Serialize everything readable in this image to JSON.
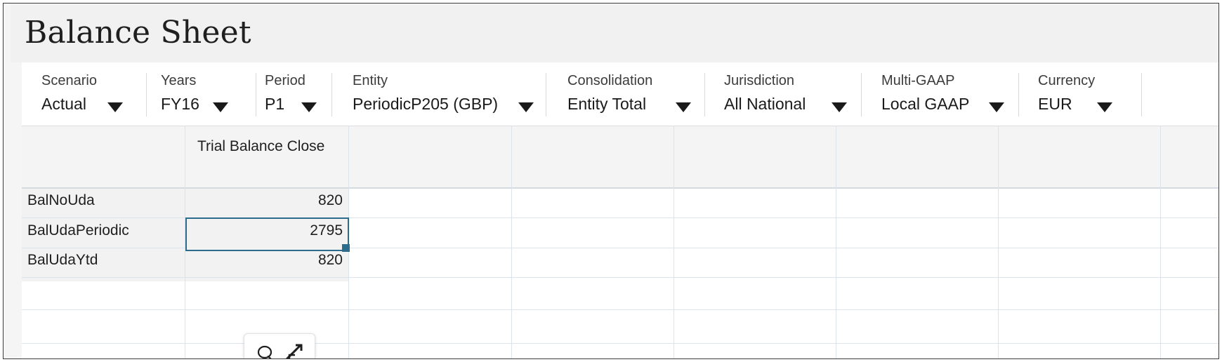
{
  "page": {
    "title": "Balance Sheet"
  },
  "pov": [
    {
      "label": "Scenario",
      "value": "Actual"
    },
    {
      "label": "Years",
      "value": "FY16"
    },
    {
      "label": "Period",
      "value": "P1"
    },
    {
      "label": "Entity",
      "value": "PeriodicP205 (GBP)"
    },
    {
      "label": "Consolidation",
      "value": "Entity Total"
    },
    {
      "label": "Jurisdiction",
      "value": "All National"
    },
    {
      "label": "Multi-GAAP",
      "value": "Local GAAP"
    },
    {
      "label": "Currency",
      "value": "EUR"
    }
  ],
  "grid": {
    "column_headers": [
      "Trial Balance Close"
    ],
    "rows": [
      {
        "label": "BalNoUda",
        "value": "820"
      },
      {
        "label": "BalUdaPeriodic",
        "value": "2795",
        "selected": true
      },
      {
        "label": "BalUdaYtd",
        "value": "820"
      }
    ]
  },
  "icons": {
    "dropdown": "caret-down-icon",
    "comment": "comment-icon",
    "drill": "drill-through-icon"
  },
  "colors": {
    "selection": "#2b6c8c"
  }
}
